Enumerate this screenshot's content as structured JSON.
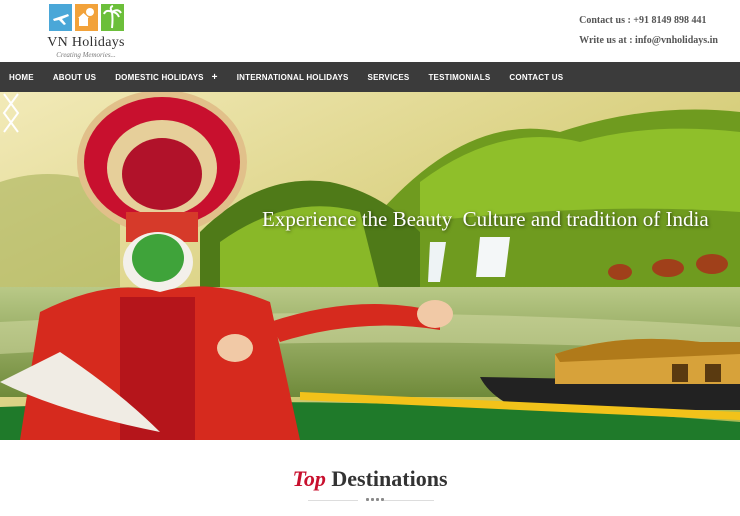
{
  "brand": {
    "name": "VN Holidays",
    "tagline": "Creating Memories..."
  },
  "contact": {
    "phone_line": "Contact us : +91 8149 898 441",
    "email_line": "Write us at : info@vnholidays.in"
  },
  "nav": {
    "items": [
      {
        "label": "HOME"
      },
      {
        "label": "ABOUT US"
      },
      {
        "label": "DOMESTIC HOLIDAYS",
        "expand": "+"
      },
      {
        "label": "INTERNATIONAL HOLIDAYS"
      },
      {
        "label": "SERVICES"
      },
      {
        "label": "TESTIMONIALS"
      },
      {
        "label": "CONTACT US"
      }
    ]
  },
  "hero": {
    "caption": "Experience the Beauty  Culture and tradition of India"
  },
  "section": {
    "title_accent": "Top",
    "title_rest": " Destinations"
  },
  "colors": {
    "nav_bg": "#3b3b3b",
    "accent_red": "#c8102e",
    "logo_tiles": [
      "#4aa7d8",
      "#f2a23a",
      "#6cbf3a"
    ]
  }
}
